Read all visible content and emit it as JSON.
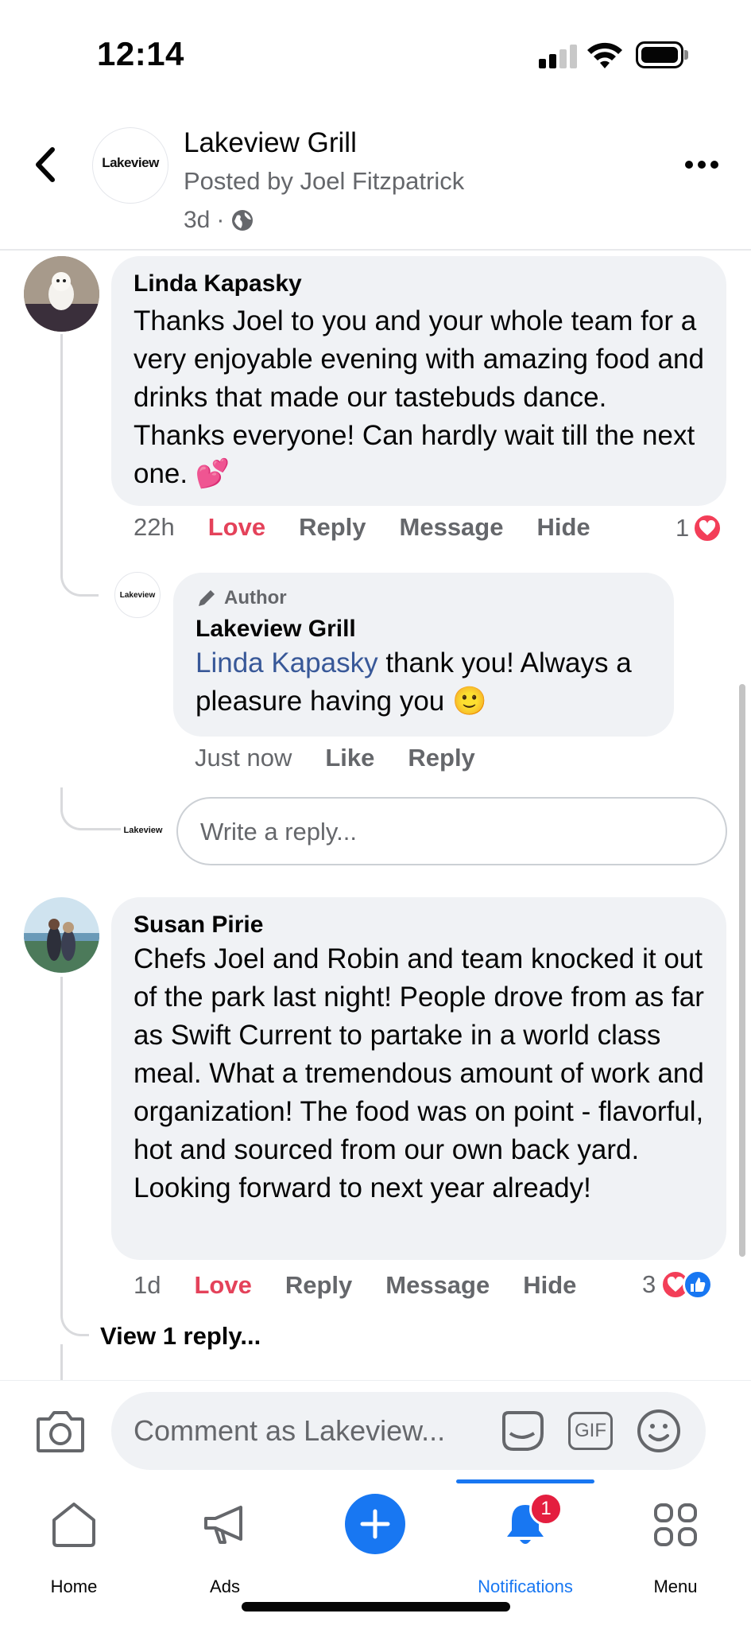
{
  "status_bar": {
    "time": "12:14"
  },
  "header": {
    "page_name": "Lakeview Grill",
    "posted_by": "Posted by Joel Fitzpatrick",
    "age": "3d",
    "separator": "·",
    "logo_text": "Lakeview"
  },
  "comments": [
    {
      "author": "Linda Kapasky",
      "text": "Thanks Joel to you and your whole team for a very enjoyable evening with amazing food and drinks that made our tastebuds dance. Thanks everyone! Can hardly wait till the next one. 💕",
      "time": "22h",
      "love_label": "Love",
      "reply_label": "Reply",
      "message_label": "Message",
      "hide_label": "Hide",
      "reaction_count": "1",
      "reply": {
        "badge": "Author",
        "author": "Lakeview Grill",
        "mention": "Linda Kapasky",
        "text": " thank you! Always a pleasure having you 🙂",
        "time": "Just now",
        "like_label": "Like",
        "reply_label": "Reply"
      },
      "reply_placeholder": "Write a reply..."
    },
    {
      "author": "Susan Pirie",
      "text": "Chefs Joel and Robin and team knocked it out of the park last night!  People drove from as far as Swift Current to partake in a world class meal.  What a tremendous amount of work and organization!  The food was on point - flavorful, hot and sourced from our own back yard.  Looking forward to next year already!",
      "time": "1d",
      "love_label": "Love",
      "reply_label": "Reply",
      "message_label": "Message",
      "hide_label": "Hide",
      "reaction_count": "3",
      "view_replies": "View 1 reply..."
    }
  ],
  "composer": {
    "placeholder": "Comment as Lakeview...",
    "gif_label": "GIF"
  },
  "tabs": [
    {
      "label": "Home",
      "icon": "home-icon"
    },
    {
      "label": "Ads",
      "icon": "megaphone-icon"
    },
    {
      "label": "",
      "icon": "plus-icon"
    },
    {
      "label": "Notifications",
      "icon": "bell-icon",
      "badge": "1",
      "active": true
    },
    {
      "label": "Menu",
      "icon": "grid-icon"
    }
  ],
  "colors": {
    "accent": "#1877f2",
    "love": "#e4425a",
    "bubble": "#f0f2f5",
    "muted": "#65676b",
    "badge": "#e41e3f"
  }
}
